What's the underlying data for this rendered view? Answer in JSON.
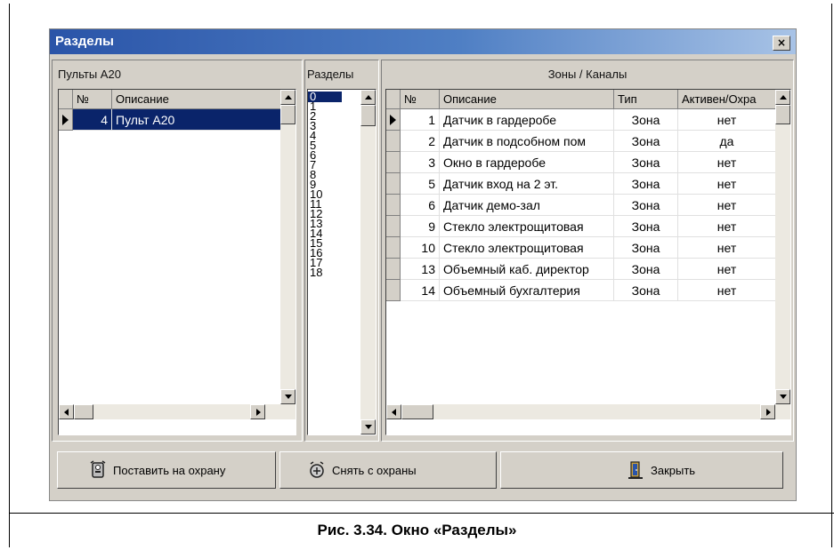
{
  "window": {
    "title": "Разделы",
    "close_glyph": "×"
  },
  "left_panel": {
    "title": "Пульты А20",
    "columns": [
      "№",
      "Описание"
    ],
    "rows": [
      {
        "num": "4",
        "desc": "Пульт А20",
        "selected": true
      }
    ]
  },
  "mid_panel": {
    "title": "Разделы",
    "items": [
      "0",
      "1",
      "2",
      "3",
      "4",
      "5",
      "6",
      "7",
      "8",
      "9",
      "10",
      "11",
      "12",
      "13",
      "14",
      "15",
      "16",
      "17",
      "18"
    ],
    "selected": "0"
  },
  "right_panel": {
    "title": "Зоны / Каналы",
    "columns": [
      "№",
      "Описание",
      "Тип",
      "Активен/Охра"
    ],
    "rows": [
      {
        "num": "1",
        "desc": "Датчик в гардеробе",
        "type": "Зона",
        "active": "нет"
      },
      {
        "num": "2",
        "desc": "Датчик в подсобном пом",
        "type": "Зона",
        "active": "да"
      },
      {
        "num": "3",
        "desc": "Окно в гардеробе",
        "type": "Зона",
        "active": "нет"
      },
      {
        "num": "5",
        "desc": "Датчик вход на 2 эт.",
        "type": "Зона",
        "active": "нет"
      },
      {
        "num": "6",
        "desc": "Датчик демо-зал",
        "type": "Зона",
        "active": "нет"
      },
      {
        "num": "9",
        "desc": "Стекло электрощитовая",
        "type": "Зона",
        "active": "нет"
      },
      {
        "num": "10",
        "desc": "Стекло электрощитовая",
        "type": "Зона",
        "active": "нет"
      },
      {
        "num": "13",
        "desc": "Объемный каб. директор",
        "type": "Зона",
        "active": "нет"
      },
      {
        "num": "14",
        "desc": "Объемный бухгалтерия",
        "type": "Зона",
        "active": "нет"
      }
    ]
  },
  "buttons": {
    "arm": "Поставить на охрану",
    "disarm": "Снять с охраны",
    "close": "Закрыть"
  },
  "caption": "Рис. 3.34. Окно «Разделы»",
  "colors": {
    "selection": "#0a246a",
    "title_start": "#2a54a8",
    "face": "#d4d0c8"
  },
  "icons": {
    "arm": "shield-arm-icon",
    "disarm": "shield-disarm-icon",
    "close": "door-exit-icon"
  }
}
